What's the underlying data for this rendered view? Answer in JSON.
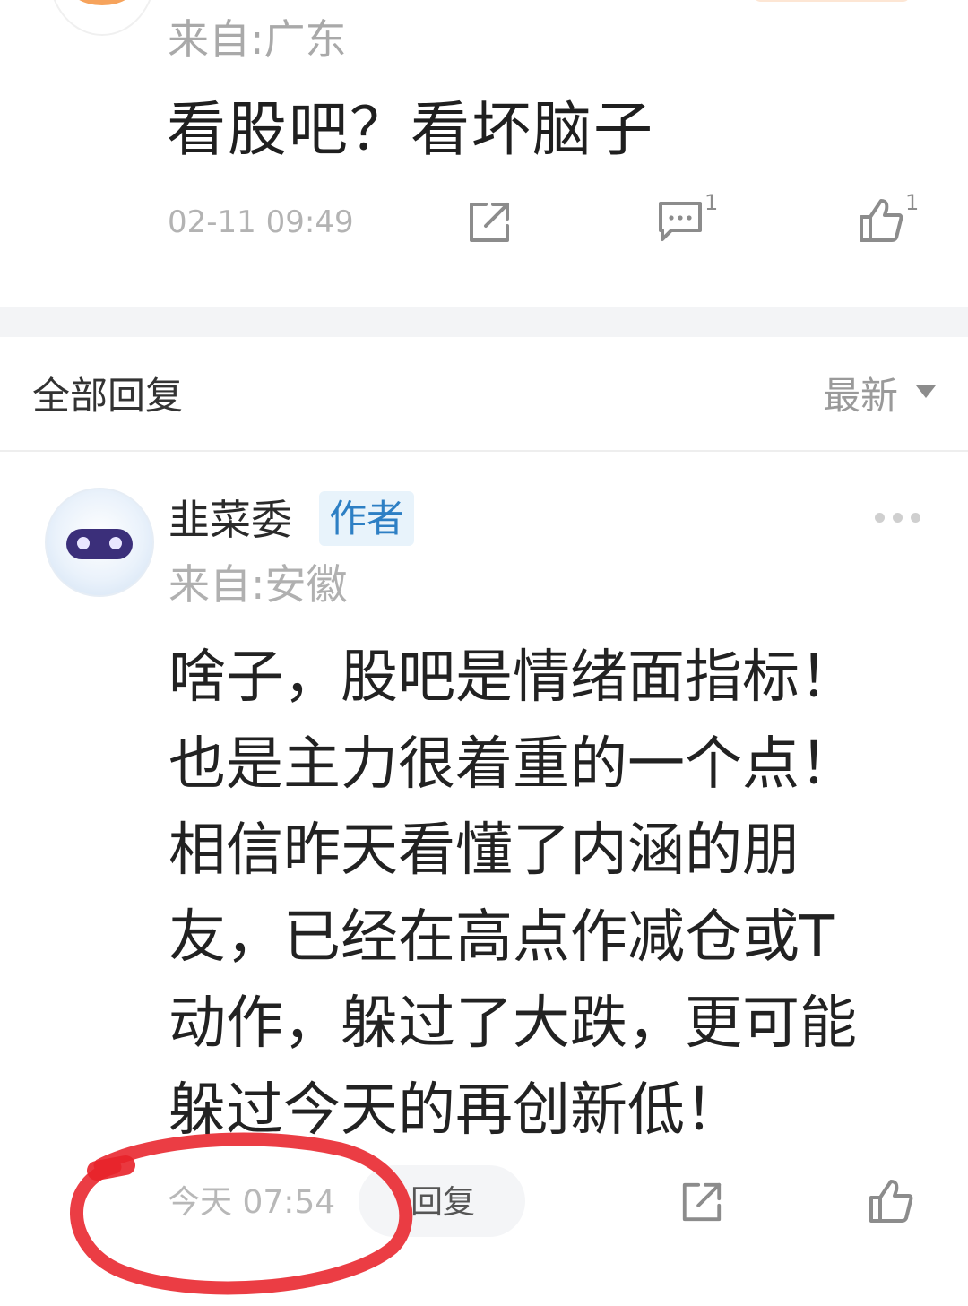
{
  "top_post": {
    "location": "来自:广东",
    "text": "看股吧？看坏脑子",
    "timestamp": "02-11 09:49",
    "comment_count": "1",
    "like_count": "1",
    "icons": [
      "share-icon",
      "comment-icon",
      "like-icon"
    ]
  },
  "replies_header": {
    "title": "全部回复",
    "sort_label": "最新",
    "sort_icon": "caret-down-icon"
  },
  "reply": {
    "username": "韭菜委",
    "badge": "作者",
    "location": "来自:安徽",
    "content_lines": [
      "啥子，股吧是情绪面指标！",
      "也是主力很着重的一个点！",
      "相信昨天看懂了内涵的朋",
      "友，已经在高点作减仓或T",
      "动作，躲过了大跌，更可能",
      "躲过今天的再创新低！"
    ],
    "timestamp": "今天 07:54",
    "reply_button_label": "回复",
    "icons": [
      "more-icon",
      "share-icon",
      "like-icon"
    ]
  },
  "colors": {
    "badge_text": "#2d7fc4",
    "badge_bg": "#e8f3fb",
    "annotation_circle": "#e8222a"
  }
}
